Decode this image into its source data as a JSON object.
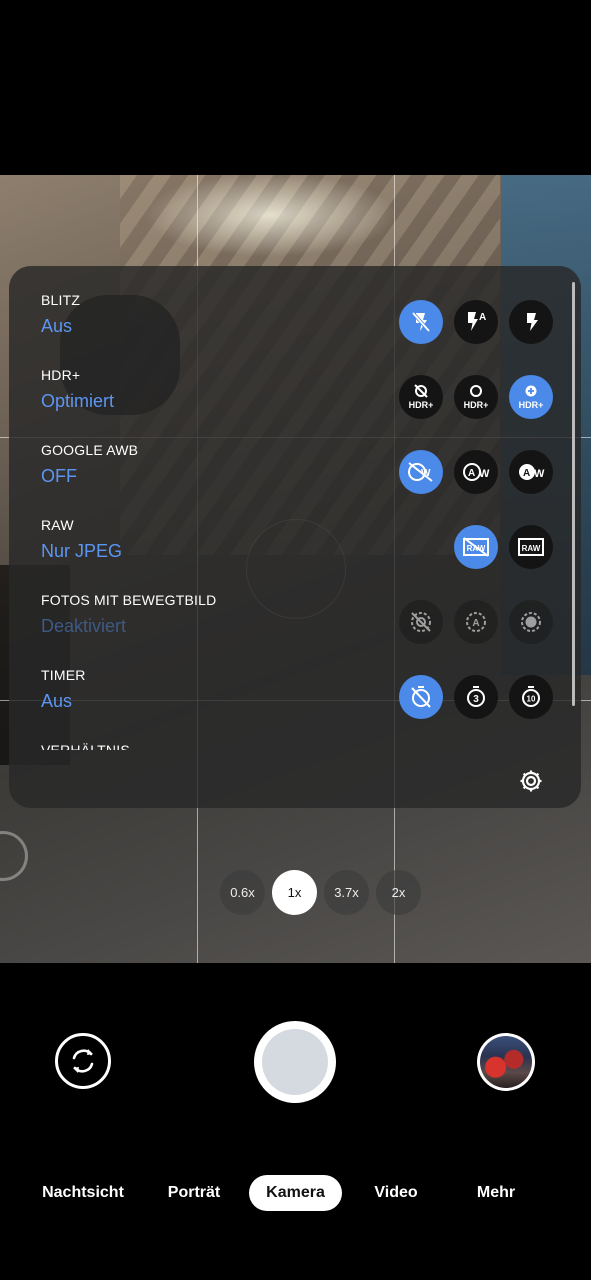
{
  "settings": {
    "blitz": {
      "title": "BLITZ",
      "value": "Aus",
      "options": [
        "flash-off-icon",
        "flash-auto-icon",
        "flash-on-icon"
      ],
      "selected": 0
    },
    "hdr": {
      "title": "HDR+",
      "value": "Optimiert",
      "options": [
        "hdr-off-icon",
        "hdr-on-icon",
        "hdr-enhanced-icon"
      ],
      "selected": 2
    },
    "awb": {
      "title": "GOOGLE AWB",
      "value": "OFF",
      "options": [
        "awb-off-icon",
        "awb-auto-icon",
        "awb-on-icon"
      ],
      "selected": 0
    },
    "raw": {
      "title": "RAW",
      "value": "Nur JPEG",
      "options": [
        "raw-off-icon",
        "raw-on-icon"
      ],
      "selected": 0
    },
    "motion": {
      "title": "FOTOS MIT BEWEGTBILD",
      "value": "Deaktiviert",
      "options": [
        "motion-off-icon",
        "motion-auto-icon",
        "motion-on-icon"
      ],
      "disabled": true
    },
    "timer": {
      "title": "TIMER",
      "value": "Aus",
      "options": [
        "timer-off-icon",
        "timer-3-icon",
        "timer-10-icon"
      ],
      "selected": 0
    },
    "ratio": {
      "title": "VERHÄLTNIS"
    }
  },
  "timer_labels": {
    "three": "3",
    "ten": "10"
  },
  "hdr_label": "HDR+",
  "raw_label": "RAW",
  "awb_label": "AW",
  "zoom": {
    "levels": [
      "0.6x",
      "1x",
      "3.7x",
      "2x"
    ],
    "active": "1x"
  },
  "modes": [
    "Nachtsicht",
    "Porträt",
    "Kamera",
    "Video",
    "Mehr"
  ],
  "active_mode": "Kamera",
  "colors": {
    "accent": "#4b8ae8",
    "value_text": "#5b96f2",
    "panel": "rgba(40,40,40,0.82)"
  }
}
